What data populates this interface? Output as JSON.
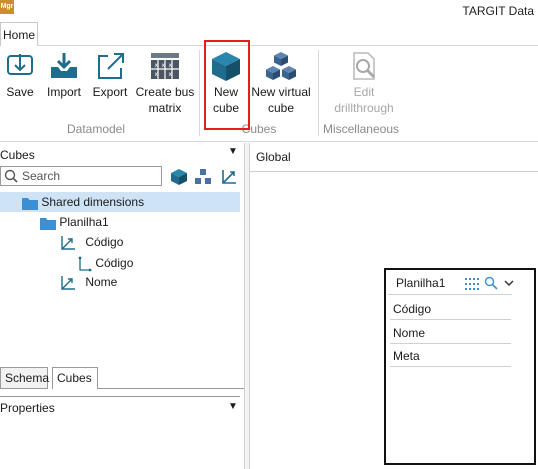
{
  "window": {
    "title": "TARGIT Data",
    "app_icon_text": "Mgr"
  },
  "ribbon": {
    "tabs": [
      "Home"
    ],
    "buttons": {
      "save": "Save",
      "import": "Import",
      "export": "Export",
      "create_bus_matrix": "Create bus\nmatrix",
      "new_cube": "New\ncube",
      "new_virtual_cube": "New virtual\ncube",
      "edit_drillthrough": "Edit\ndrillthrough"
    },
    "groups": {
      "datamodel": "Datamodel",
      "cubes": "Cubes",
      "miscellaneous": "Miscellaneous"
    }
  },
  "left_panel": {
    "header": "Cubes",
    "search_placeholder": "Search",
    "tree": {
      "root": "Shared dimensions",
      "folder": "Planilha1",
      "dim1": "Código",
      "dim1_child": "Código",
      "dim2": "Nome"
    },
    "bottom_tabs": [
      "Schema",
      "Cubes"
    ],
    "properties_header": "Properties"
  },
  "main": {
    "global_label": "Global",
    "table_box": {
      "title": "Planilha1",
      "fields": [
        "Código",
        "Nome",
        "Meta"
      ]
    }
  },
  "colors": {
    "accent_cube": "#1f6c8e",
    "highlight": "#e02020",
    "selection": "#cfe3f7"
  }
}
